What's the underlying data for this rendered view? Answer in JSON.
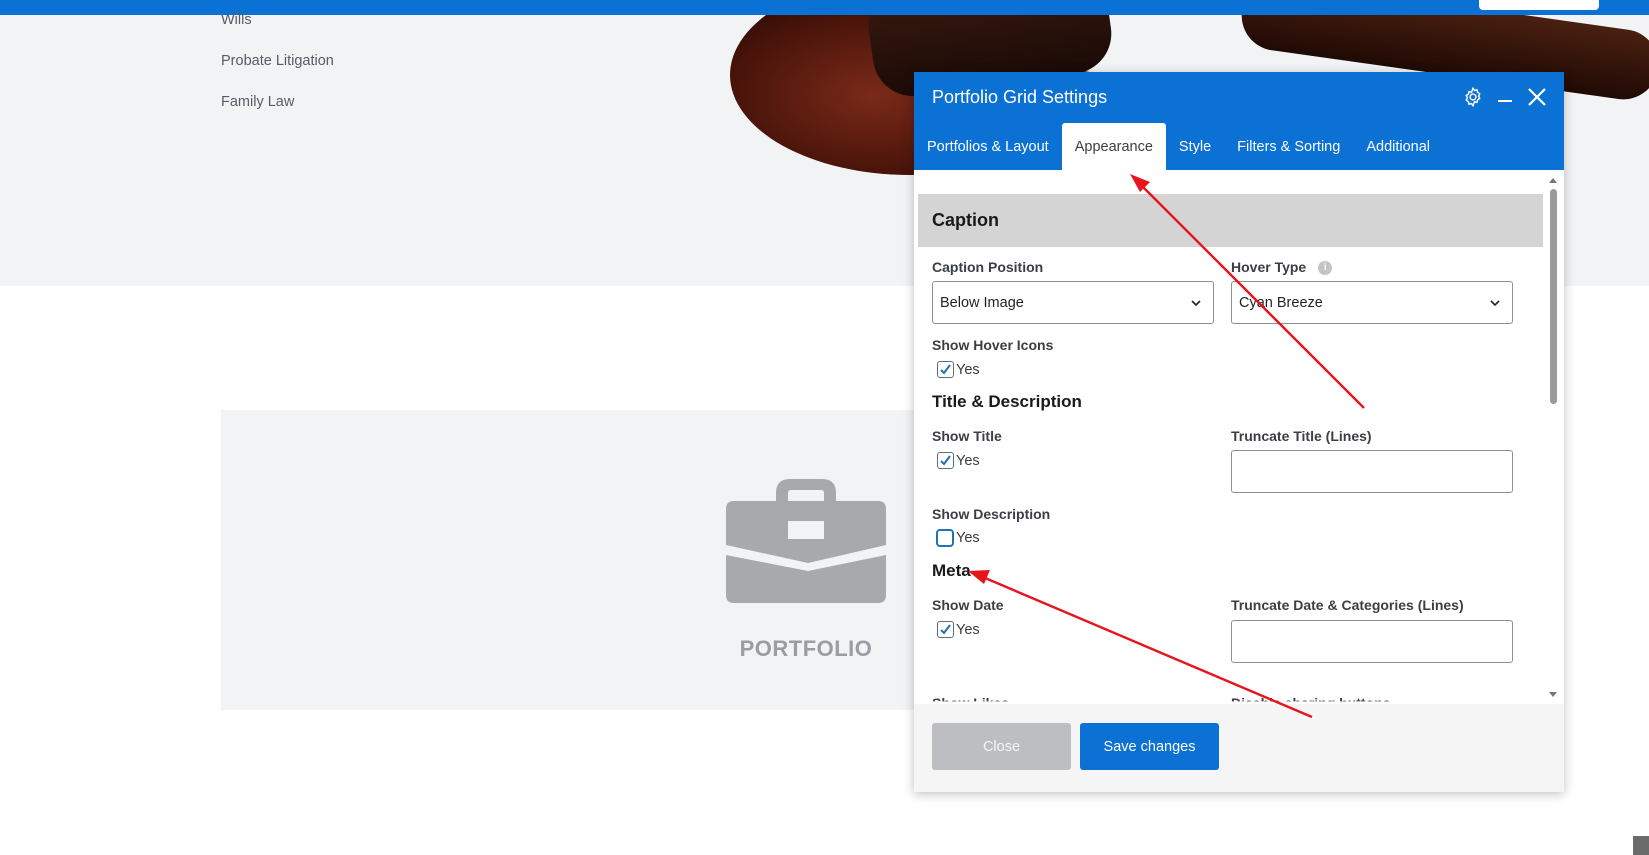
{
  "background": {
    "side_links": [
      "Wills",
      "Probate Litigation",
      "Family Law"
    ],
    "portfolio_label": "PORTFOLIO"
  },
  "modal": {
    "title": "Portfolio Grid Settings",
    "header_icons": [
      "gear-icon",
      "minimize-icon",
      "close-icon"
    ],
    "tabs": [
      {
        "label": "Portfolios & Layout",
        "active": false
      },
      {
        "label": "Appearance",
        "active": true
      },
      {
        "label": "Style",
        "active": false
      },
      {
        "label": "Filters & Sorting",
        "active": false
      },
      {
        "label": "Additional",
        "active": false
      }
    ],
    "caption_section": {
      "heading": "Caption",
      "caption_position_label": "Caption Position",
      "caption_position_value": "Below Image",
      "hover_type_label": "Hover Type",
      "hover_type_value": "Cyan Breeze",
      "show_hover_icons_label": "Show Hover Icons",
      "show_hover_icons_option": "Yes",
      "show_hover_icons_checked": true
    },
    "title_description_section": {
      "heading": "Title & Description",
      "show_title_label": "Show Title",
      "show_title_option": "Yes",
      "show_title_checked": true,
      "truncate_title_label": "Truncate Title (Lines)",
      "truncate_title_value": "",
      "show_description_label": "Show Description",
      "show_description_option": "Yes",
      "show_description_checked": false
    },
    "meta_section": {
      "heading": "Meta",
      "show_date_label": "Show Date",
      "show_date_option": "Yes",
      "show_date_checked": true,
      "truncate_date_label": "Truncate Date & Categories (Lines)",
      "truncate_date_value": "",
      "show_likes_label": "Show Likes",
      "disable_sharing_label": "Disable sharing buttons"
    },
    "footer": {
      "close_label": "Close",
      "save_label": "Save changes"
    }
  },
  "colors": {
    "accent": "#0c71d4",
    "annotation_arrow": "#e8141b",
    "section_header_bg": "#d4d4d4",
    "close_button_bg": "#bcbec2"
  }
}
